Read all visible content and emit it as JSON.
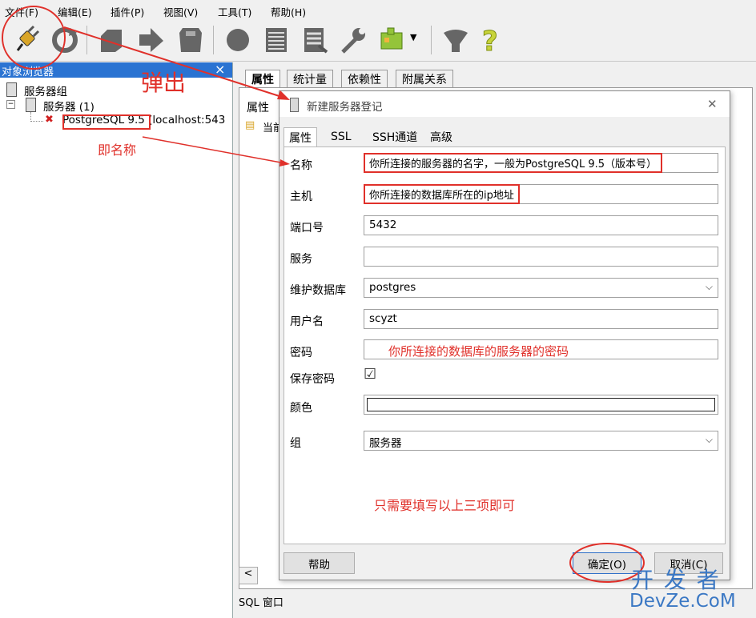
{
  "menu": [
    "文件(F)",
    "编辑(E)",
    "插件(P)",
    "视图(V)",
    "工具(T)",
    "帮助(H)"
  ],
  "toolbar": {
    "icons": [
      "plug-icon",
      "refresh-icon",
      "object-icon",
      "create-icon",
      "drop-icon",
      "sql-icon",
      "table-icon",
      "data-icon",
      "wrench-icon",
      "plugin-icon",
      "filter-icon",
      "help-icon"
    ]
  },
  "browser": {
    "title": "对象浏览器",
    "close": "×",
    "tree": {
      "group": "服务器组",
      "servers": "服务器 (1)",
      "server_name": "PostgreSQL 9.5",
      "server_host": " (localhost:543"
    },
    "scroll_left": "<"
  },
  "right_pane": {
    "tabs": [
      "属性",
      "统计量",
      "依赖性",
      "附属关系"
    ],
    "sub_label": "属性",
    "sub_label2": "当前",
    "sql_window": "SQL 窗口"
  },
  "dialog": {
    "title": "新建服务器登记",
    "close": "✕",
    "tabs": [
      "属性",
      "SSL",
      "SSH通道",
      "高级"
    ],
    "fields": {
      "name_label": "名称",
      "name_value": "你所连接的服务器的名字，一般为PostgreSQL 9.5（版本号）",
      "host_label": "主机",
      "host_value": "你所连接的数据库所在的ip地址",
      "port_label": "端口号",
      "port_value": "5432",
      "service_label": "服务",
      "service_value": "",
      "maint_label": "维护数据库",
      "maint_value": "postgres",
      "user_label": "用户名",
      "user_value": "scyzt",
      "password_label": "密码",
      "password_value": "你所连接的数据库的服务器的密码",
      "savepw_label": "保存密码",
      "savepw_check": "☑",
      "color_label": "颜色",
      "group_label": "组",
      "group_value": "服务器"
    },
    "note": "只需要填写以上三项即可",
    "buttons": {
      "help": "帮助",
      "ok": "确定(O)",
      "cancel": "取消(C)"
    }
  },
  "annotations": {
    "popup": "弹出",
    "name_hint": "即名称"
  },
  "watermark": {
    "line1": "开 发 者",
    "line2": "DevZe.CoM"
  },
  "colors": {
    "annotation_red": "#e0302a",
    "selection_blue": "#2a73d2"
  }
}
